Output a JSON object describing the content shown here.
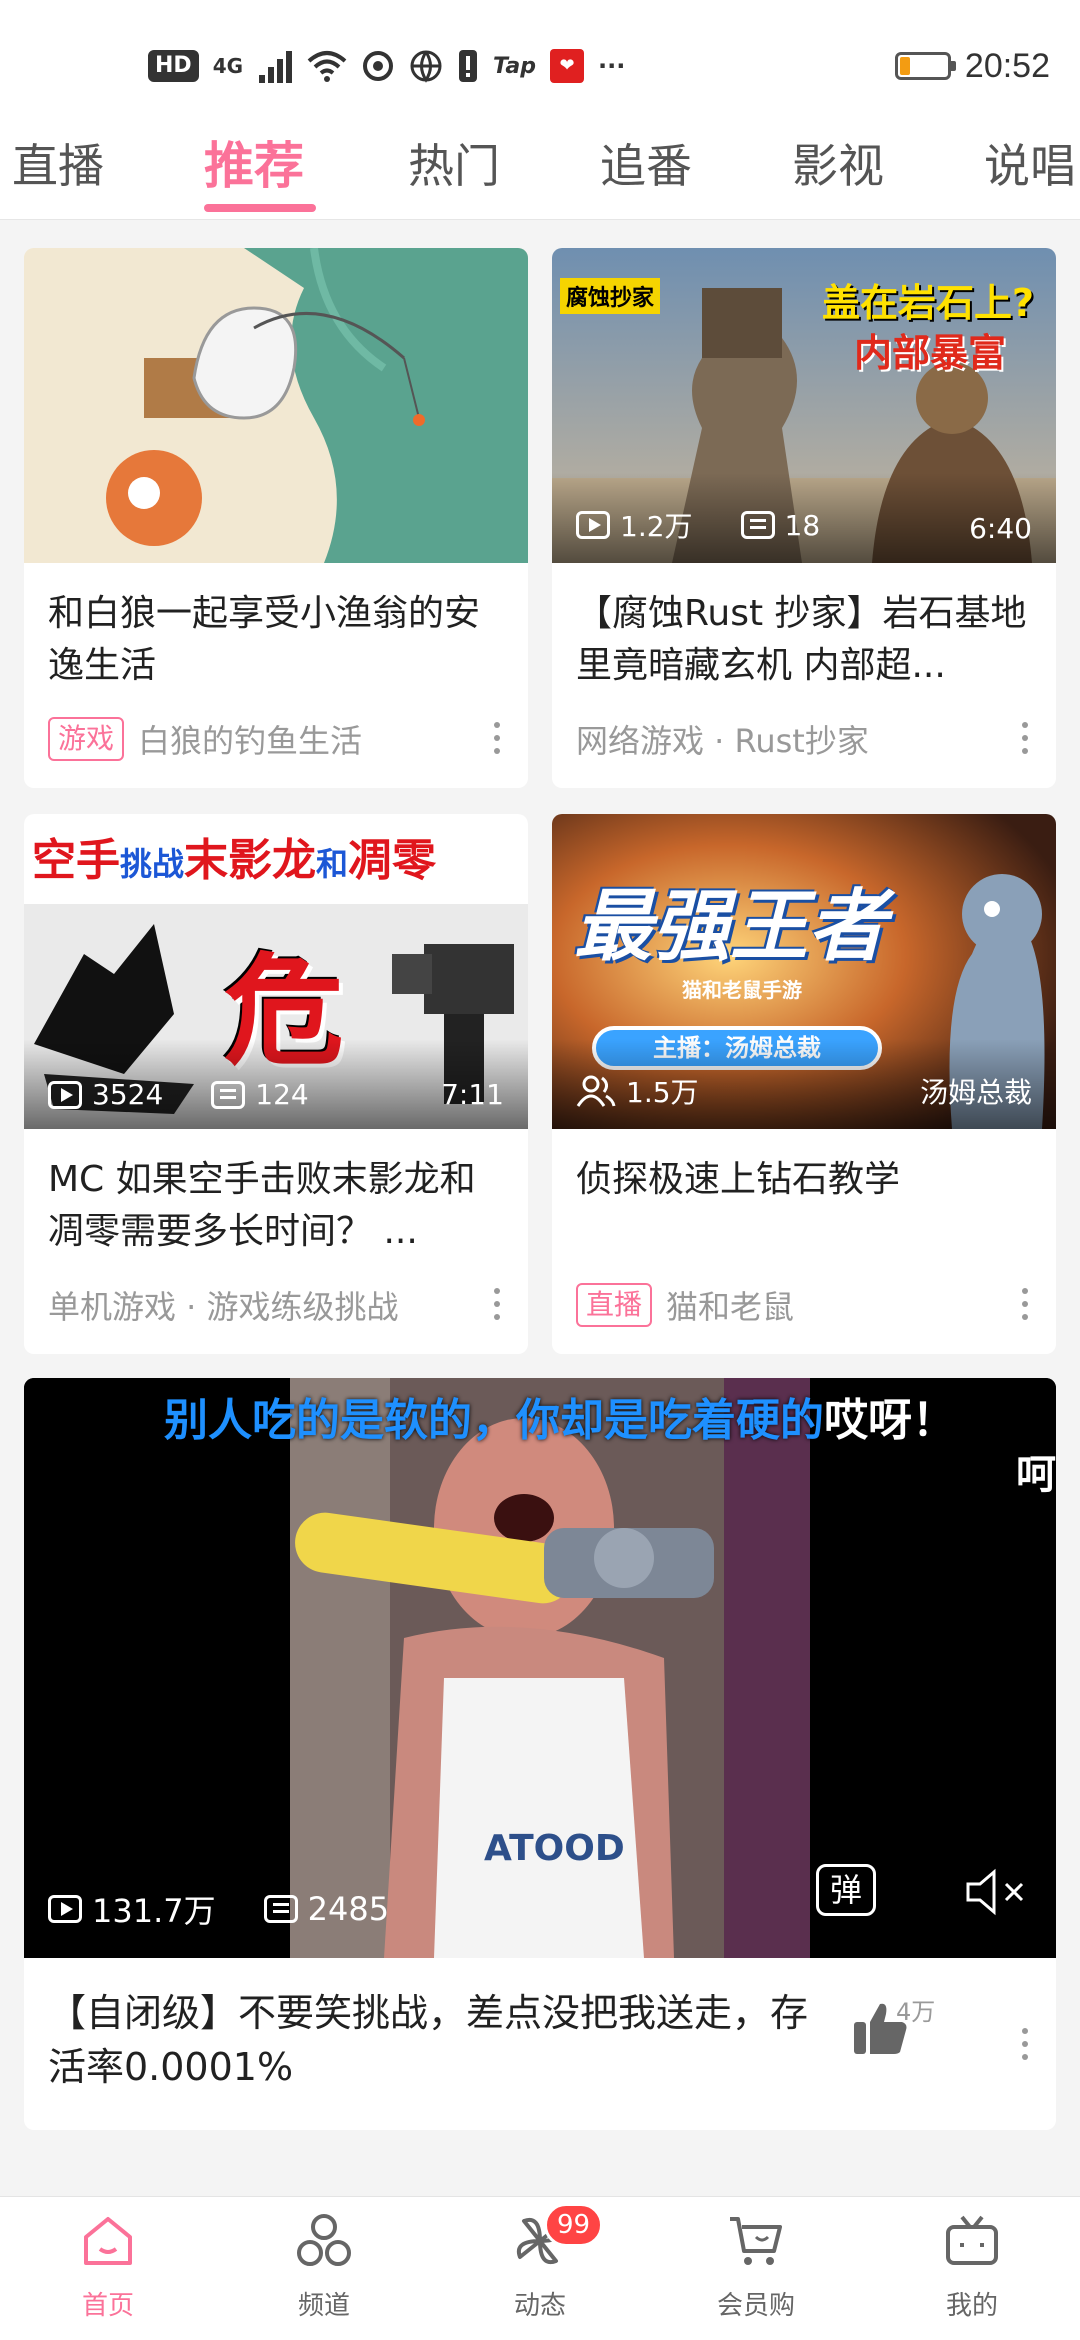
{
  "status_bar": {
    "hd": "HD",
    "network": "4G",
    "tap": "Tap",
    "overflow": "···",
    "time": "20:52",
    "battery_level": 0.2
  },
  "tabs": [
    "直播",
    "推荐",
    "热门",
    "追番",
    "影视",
    "说唱"
  ],
  "active_tab": "推荐",
  "cards": [
    {
      "title": "和白狼一起享受小渔翁的安逸生活",
      "badge": "游戏",
      "meta": "白狼的钓鱼生活"
    },
    {
      "thumb_tag": "腐蚀抄家",
      "thumb_headline_1": "盖在岩石上?",
      "thumb_headline_2": "内部暴富",
      "views": "1.2万",
      "danmaku": "18",
      "duration": "6:40",
      "title": "【腐蚀Rust 抄家】岩石基地里竟暗藏玄机 内部超...",
      "meta": "网络游戏 · Rust抄家"
    },
    {
      "thumb_headline_1": "空手",
      "thumb_headline_2": "挑战",
      "thumb_headline_3": "末影龙",
      "thumb_headline_4": "和",
      "thumb_headline_5": "凋零",
      "thumb_big": "危",
      "views": "3524",
      "danmaku": "124",
      "duration": "7:11",
      "title": "MC 如果空手击败末影龙和凋零需要多长时间？ ...",
      "meta": "单机游戏 · 游戏练级挑战"
    },
    {
      "thumb_logo": "最强王者",
      "thumb_sublogo": "猫和老鼠手游",
      "thumb_host": "主播：汤姆总裁",
      "viewers": "1.5万",
      "streamer": "汤姆总裁",
      "title": "侦探极速上钻石教学",
      "badge": "直播",
      "meta": "猫和老鼠"
    }
  ],
  "featured": {
    "subtitle_blue": "别人吃的是软的，你却是吃着硬的",
    "subtitle_white": "哎呀！",
    "subtitle_cut": "呵",
    "shirt_text": "ATOOD",
    "views": "131.7万",
    "danmaku": "2485",
    "danmaku_toggle": "弹",
    "title": "【自闭级】不要笑挑战，差点没把我送走，存活率0.0001%",
    "likes": "4万"
  },
  "bottom_nav": [
    {
      "label": "首页",
      "icon": "home-icon"
    },
    {
      "label": "频道",
      "icon": "channel-icon"
    },
    {
      "label": "动态",
      "icon": "dynamic-icon",
      "badge": "99"
    },
    {
      "label": "会员购",
      "icon": "cart-icon"
    },
    {
      "label": "我的",
      "icon": "tv-icon"
    }
  ],
  "colors": {
    "accent": "#fb7299",
    "background": "#f4f4f4"
  }
}
